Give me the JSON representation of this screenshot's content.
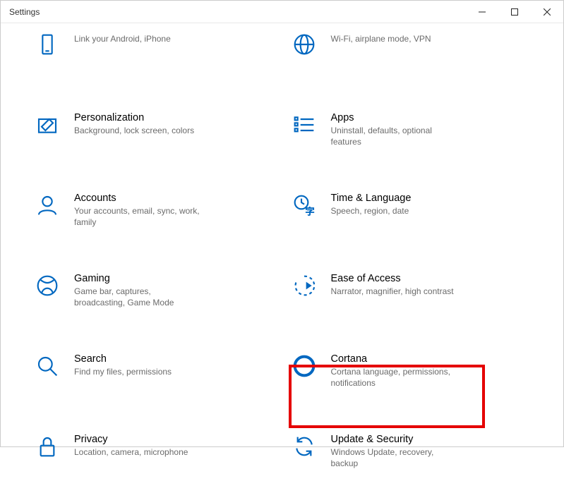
{
  "window": {
    "title": "Settings"
  },
  "tiles": [
    {
      "title": "",
      "desc": "Link your Android, iPhone"
    },
    {
      "title": "",
      "desc": "Wi-Fi, airplane mode, VPN"
    },
    {
      "title": "Personalization",
      "desc": "Background, lock screen, colors"
    },
    {
      "title": "Apps",
      "desc": "Uninstall, defaults, optional features"
    },
    {
      "title": "Accounts",
      "desc": "Your accounts, email, sync, work, family"
    },
    {
      "title": "Time & Language",
      "desc": "Speech, region, date"
    },
    {
      "title": "Gaming",
      "desc": "Game bar, captures, broadcasting, Game Mode"
    },
    {
      "title": "Ease of Access",
      "desc": "Narrator, magnifier, high contrast"
    },
    {
      "title": "Search",
      "desc": "Find my files, permissions"
    },
    {
      "title": "Cortana",
      "desc": "Cortana language, permissions, notifications"
    },
    {
      "title": "Privacy",
      "desc": "Location, camera, microphone"
    },
    {
      "title": "Update & Security",
      "desc": "Windows Update, recovery, backup"
    }
  ],
  "highlight": {
    "target": "update-security-tile"
  }
}
